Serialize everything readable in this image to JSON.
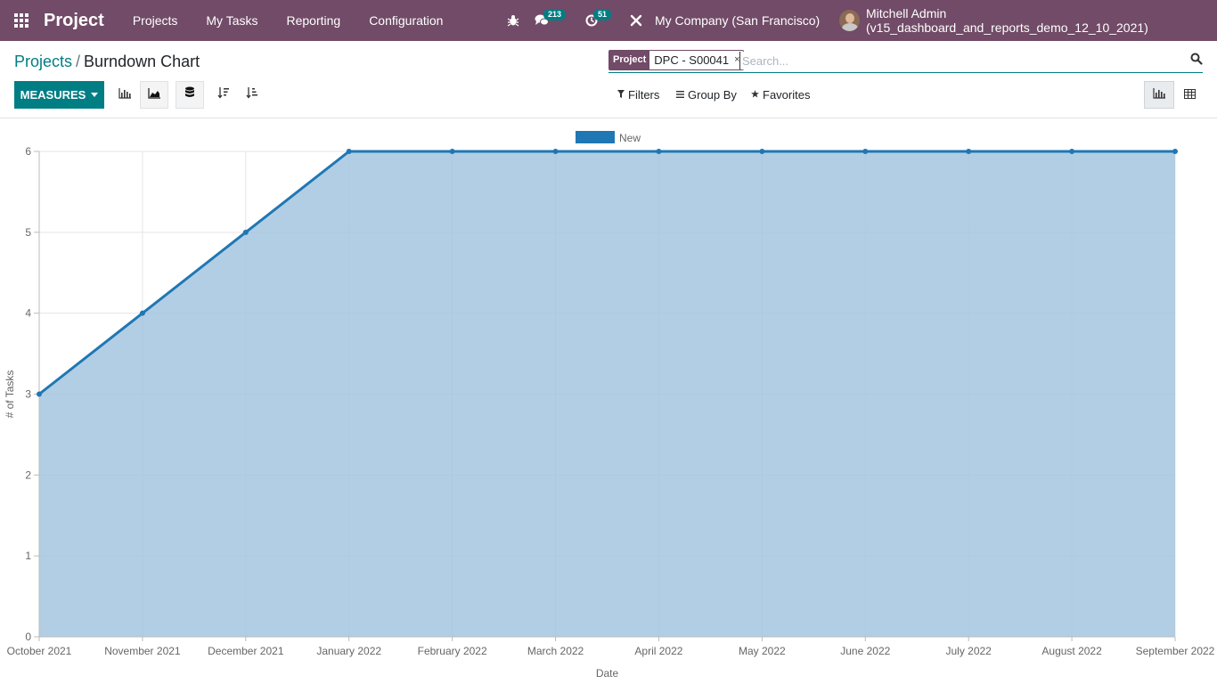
{
  "navbar": {
    "brand": "Project",
    "menu": [
      "Projects",
      "My Tasks",
      "Reporting",
      "Configuration"
    ],
    "messages_count": "213",
    "activities_count": "51",
    "company": "My Company (San Francisco)",
    "user": "Mitchell Admin (v15_dashboard_and_reports_demo_12_10_2021)"
  },
  "breadcrumb": {
    "parent": "Projects",
    "separator": "/",
    "current": "Burndown Chart"
  },
  "search": {
    "facet_label": "Project",
    "facet_value": "DPC - S00041",
    "facet_remove": "×",
    "placeholder": "Search..."
  },
  "toolbar": {
    "measures_label": "MEASURES"
  },
  "search_panel": {
    "filters": "Filters",
    "group_by": "Group By",
    "favorites": "Favorites"
  },
  "colors": {
    "navbar": "#714B67",
    "accent": "#017e84",
    "series_line": "#1f77b4",
    "series_fill": "#a4c6df"
  },
  "chart_data": {
    "type": "area",
    "categories": [
      "October 2021",
      "November 2021",
      "December 2021",
      "January 2022",
      "February 2022",
      "March 2022",
      "April 2022",
      "May 2022",
      "June 2022",
      "July 2022",
      "August 2022",
      "September 2022"
    ],
    "series": [
      {
        "name": "New",
        "values": [
          3,
          4,
          5,
          6,
          6,
          6,
          6,
          6,
          6,
          6,
          6,
          6
        ]
      }
    ],
    "xlabel": "Date",
    "ylabel": "# of Tasks",
    "ylim": [
      0,
      6
    ],
    "yticks": [
      0,
      1,
      2,
      3,
      4,
      5,
      6
    ],
    "grid": true,
    "legend_position": "top-center"
  }
}
